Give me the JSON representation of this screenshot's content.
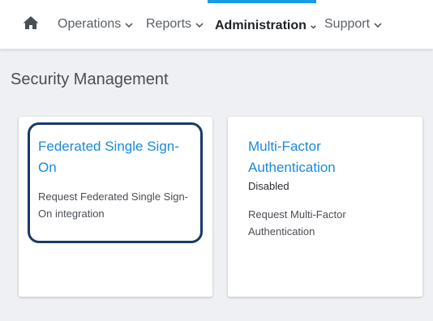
{
  "nav": {
    "home_icon": "home-icon",
    "items": [
      {
        "label": "Operations",
        "active": false
      },
      {
        "label": "Reports",
        "active": false
      },
      {
        "label": "Administration",
        "active": true
      },
      {
        "label": "Support",
        "active": false
      }
    ],
    "accent_color": "#1a9be6"
  },
  "page": {
    "title": "Security Management"
  },
  "cards": [
    {
      "title": "Federated Single Sign-On",
      "status": "",
      "description": "Request Federated Single Sign-On integration",
      "focused": true
    },
    {
      "title": "Multi-Factor Authentication",
      "status": "Disabled",
      "description": "Request Multi-Factor Authentication",
      "focused": false
    }
  ],
  "colors": {
    "link": "#1a8ad8",
    "focus_ring": "#163a6b",
    "background": "#eff0f3"
  }
}
